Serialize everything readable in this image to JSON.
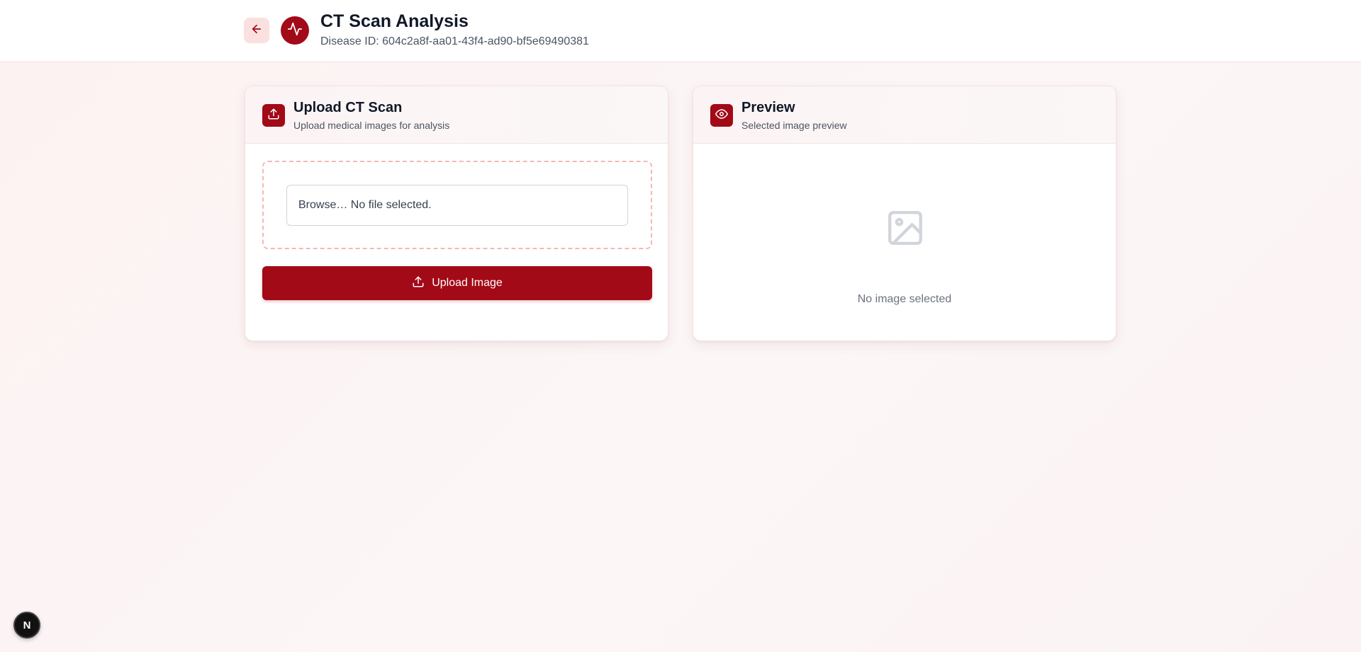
{
  "header": {
    "title": "CT Scan Analysis",
    "subtitle": "Disease ID: 604c2a8f-aa01-43f4-ad90-bf5e69490381",
    "back_icon": "arrow-left-icon",
    "logo_icon": "activity-pulse-icon"
  },
  "upload_card": {
    "title": "Upload CT Scan",
    "subtitle": "Upload medical images for analysis",
    "icon": "upload-icon",
    "file_input_text": "Browse… No file selected.",
    "button_label": "Upload Image",
    "button_icon": "upload-icon"
  },
  "preview_card": {
    "title": "Preview",
    "subtitle": "Selected image preview",
    "icon": "eye-icon",
    "empty_icon": "image-placeholder-icon",
    "empty_text": "No image selected"
  },
  "dev_badge": {
    "label": "N",
    "icon": "nextjs-logo-icon"
  },
  "colors": {
    "accent": "#a20a17",
    "accent_light": "#fbe0e0",
    "dropzone_border": "#f3b8b8",
    "background": "#fdf2f2"
  }
}
